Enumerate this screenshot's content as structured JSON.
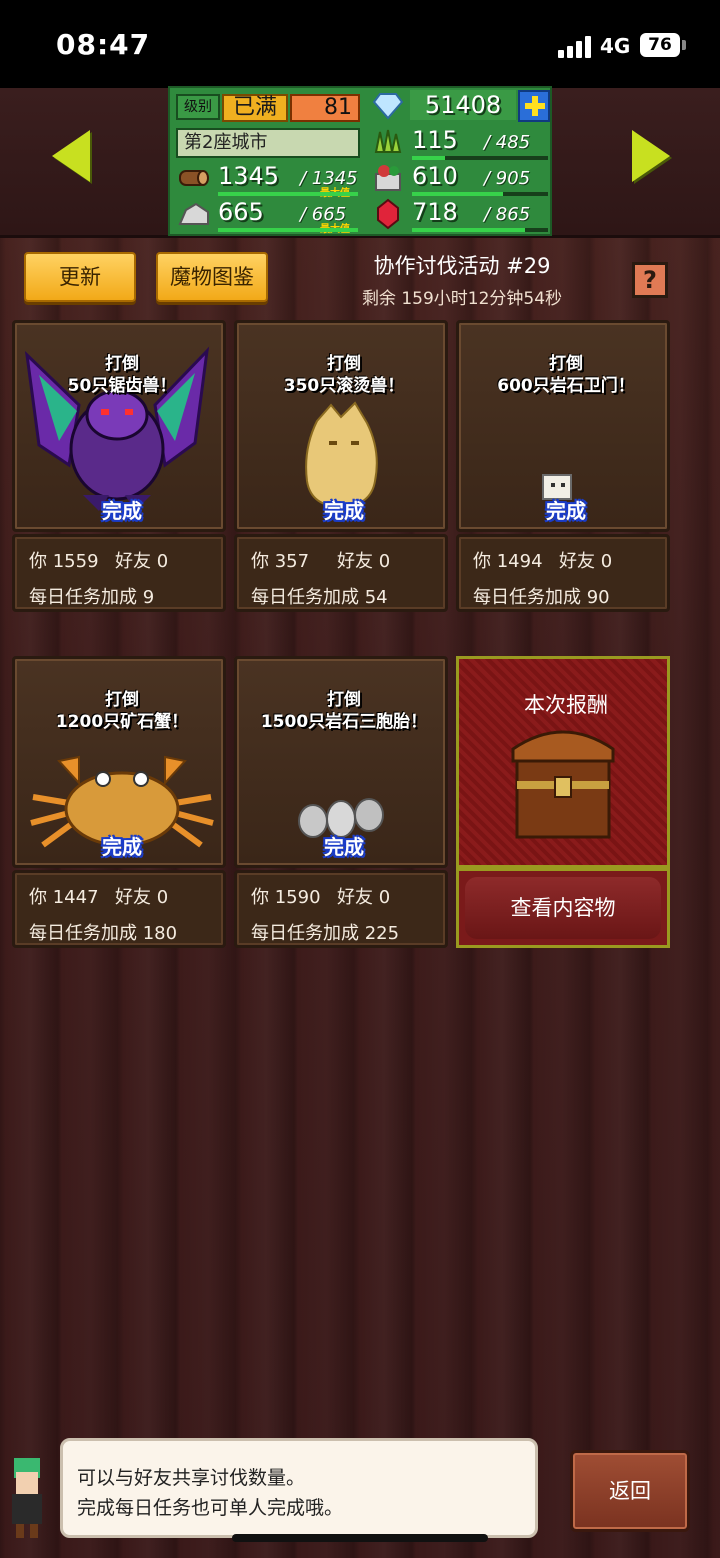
{
  "status_bar": {
    "time": "08:47",
    "network": "4G",
    "battery": "76"
  },
  "resources": {
    "level_label": "级别",
    "level_status": "已满",
    "level_value": "81",
    "city": "第2座城市",
    "gems": "51408",
    "wood": {
      "value": "1345",
      "max": "/ 1345",
      "tag": "最大值",
      "fill": 1.0
    },
    "stone": {
      "value": "665",
      "max": "/ 665",
      "tag": "最大值",
      "fill": 1.0
    },
    "grass": {
      "value": "115",
      "max": "/ 485",
      "fill": 0.24
    },
    "food": {
      "value": "610",
      "max": "/ 905",
      "fill": 0.67
    },
    "ruby": {
      "value": "718",
      "max": "/ 865",
      "fill": 0.83
    }
  },
  "toolbar": {
    "refresh": "更新",
    "bestiary": "魔物图鉴",
    "event_title": "协作讨伐活动 #29",
    "event_remaining": "剩余 159小时12分钟54秒",
    "help": "?"
  },
  "cards": [
    {
      "line1": "打倒",
      "line2": "50只锯齿兽！",
      "status": "完成",
      "you": "你  1559",
      "friend": "好友  0",
      "bonus": "每日任务加成  9",
      "monster": "winged-demon"
    },
    {
      "line1": "打倒",
      "line2": "350只滚烫兽！",
      "status": "完成",
      "you": "你  357",
      "friend": "好友  0",
      "bonus": "每日任务加成  54",
      "monster": "golden-blob"
    },
    {
      "line1": "打倒",
      "line2": "600只岩石卫门！",
      "status": "完成",
      "you": "你  1494",
      "friend": "好友  0",
      "bonus": "每日任务加成  90",
      "monster": "small-rock"
    },
    {
      "line1": "打倒",
      "line2": "1200只矿石蟹！",
      "status": "完成",
      "you": "你  1447",
      "friend": "好友  0",
      "bonus": "每日任务加成  180",
      "monster": "ore-crab"
    },
    {
      "line1": "打倒",
      "line2": "1500只岩石三胞胎！",
      "status": "完成",
      "you": "你  1590",
      "friend": "好友  0",
      "bonus": "每日任务加成  225",
      "monster": "rock-triplets"
    }
  ],
  "reward": {
    "title": "本次报酬",
    "button": "查看内容物"
  },
  "footer": {
    "tip_line1": "可以与好友共享讨伐数量。",
    "tip_line2": "完成每日任务也可单人完成哦。",
    "back": "返回"
  },
  "colors": {
    "accent_green": "#2f8a3d",
    "arrow": "#c8e020",
    "button_yellow": "#f2a918",
    "done_outline": "#1a3cc8"
  }
}
